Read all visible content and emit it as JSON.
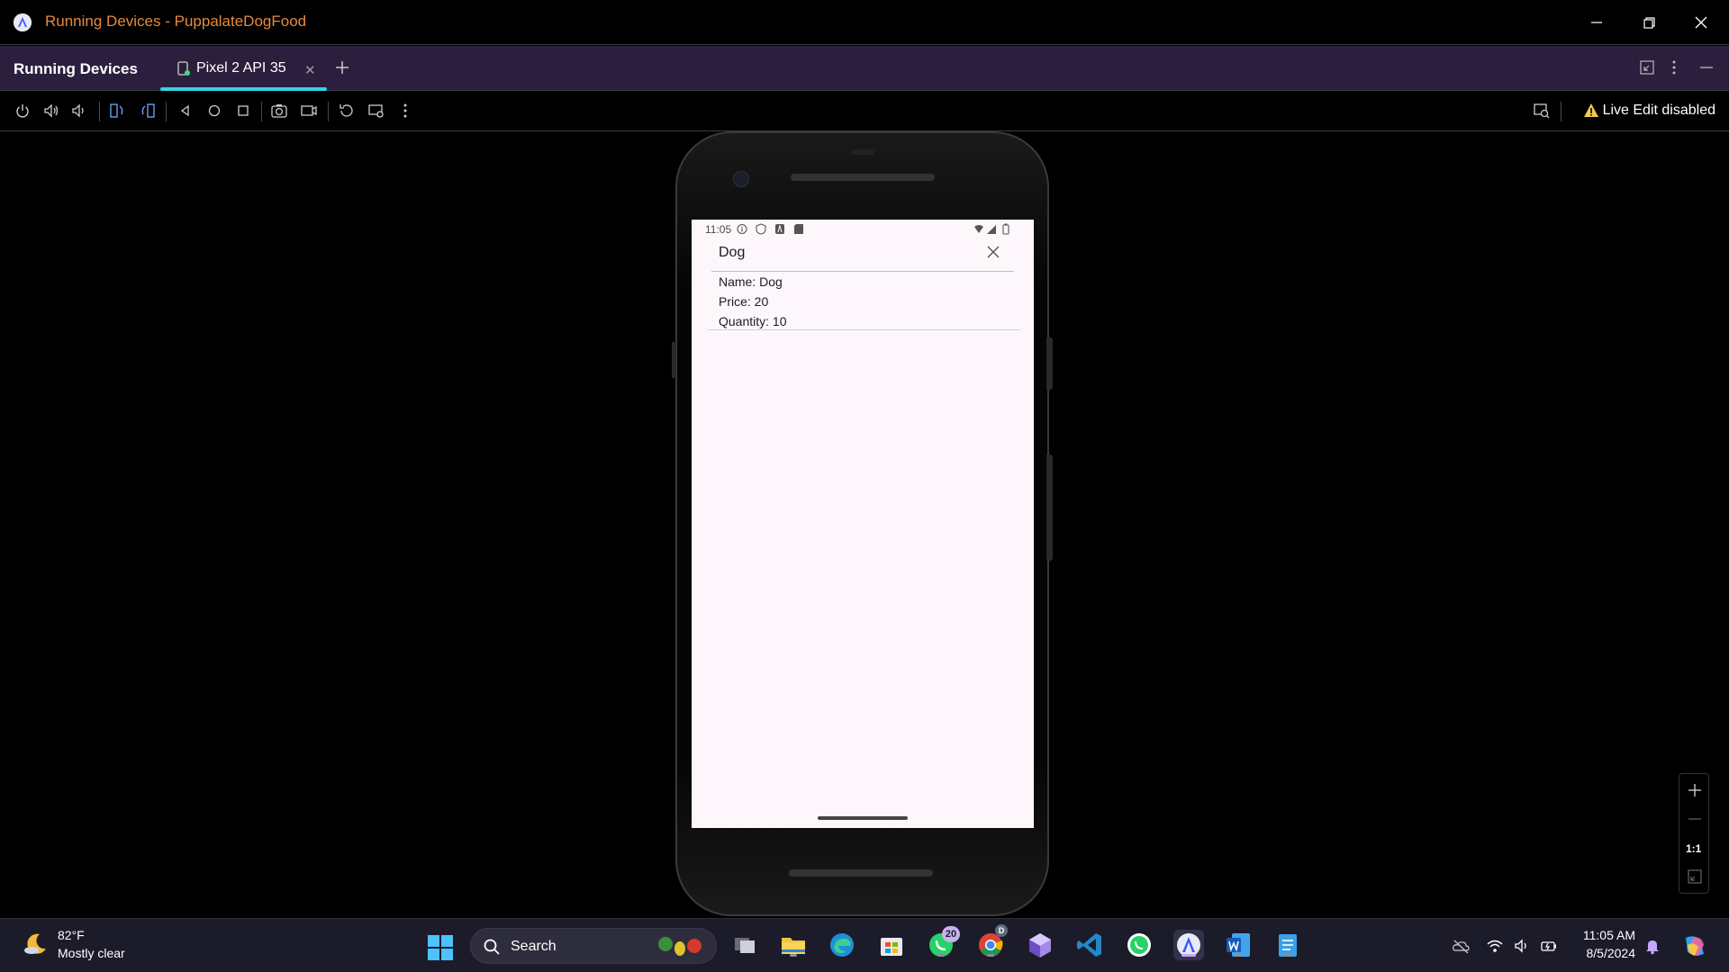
{
  "window": {
    "title": "Running Devices - PuppalateDogFood"
  },
  "toolwindow": {
    "title": "Running Devices",
    "tabs": [
      {
        "label": "Pixel 2 API 35"
      }
    ]
  },
  "toolbar": {
    "live_edit_status": "Live Edit disabled"
  },
  "device": {
    "status_time": "11:05",
    "dialog": {
      "title": "Dog",
      "details": [
        "Name: Dog",
        "Price: 20",
        "Quantity: 10"
      ]
    }
  },
  "zoom": {
    "actual_size_label": "1:1"
  },
  "taskbar": {
    "weather_temp": "82°F",
    "weather_desc": "Mostly clear",
    "search_label": "Search",
    "whatsapp_badge": "20",
    "chrome_badge": "D",
    "time": "11:05 AM",
    "date": "8/5/2024"
  }
}
